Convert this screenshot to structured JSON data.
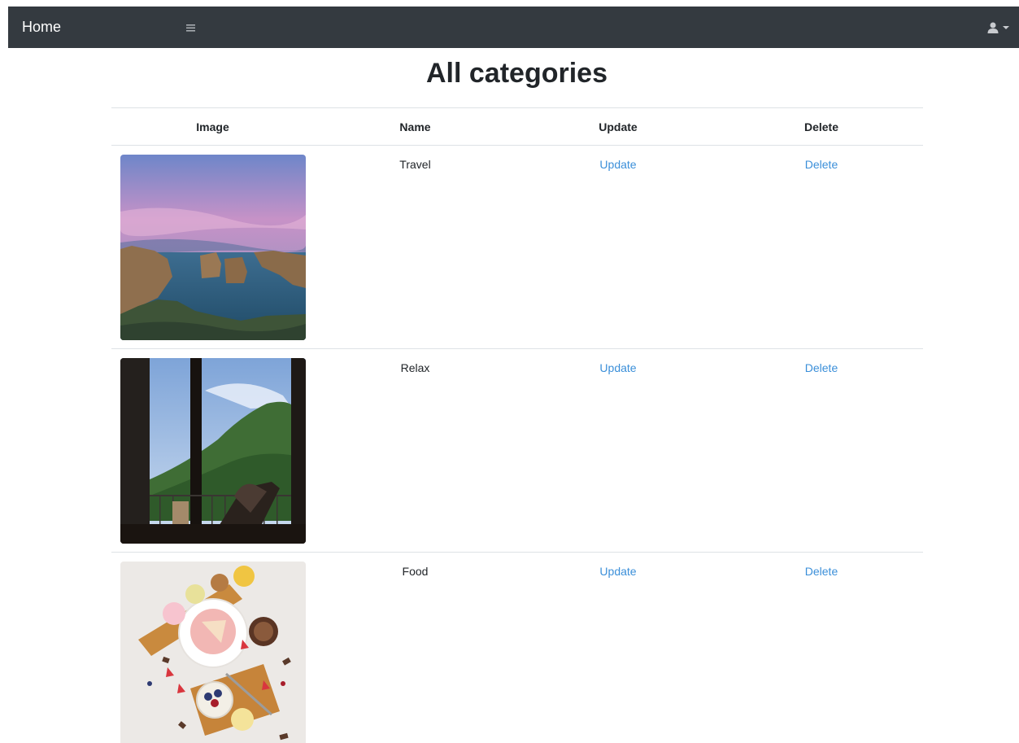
{
  "navbar": {
    "brand": "Home",
    "menu_icon": "hamburger-icon",
    "user_icon": "user-icon",
    "dropdown_icon": "caret-down-icon",
    "background": "#343a40"
  },
  "page": {
    "title": "All categories"
  },
  "table": {
    "headers": [
      "Image",
      "Name",
      "Update",
      "Delete"
    ],
    "rows": [
      {
        "name": "Travel",
        "update_label": "Update",
        "delete_label": "Delete"
      },
      {
        "name": "Relax",
        "update_label": "Update",
        "delete_label": "Delete"
      },
      {
        "name": "Food",
        "update_label": "Update",
        "delete_label": "Delete"
      }
    ]
  },
  "colors": {
    "link": "#3b8fd9",
    "border": "#dee2e6",
    "text": "#212529"
  }
}
